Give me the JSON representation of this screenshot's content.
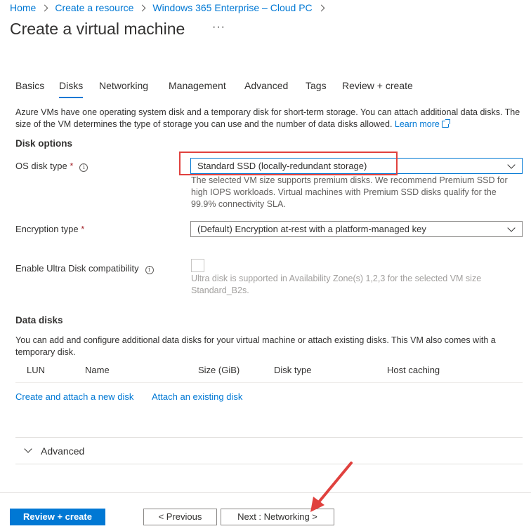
{
  "breadcrumb": [
    "Home",
    "Create a resource",
    "Windows 365 Enterprise – Cloud PC"
  ],
  "page_title": "Create a virtual machine",
  "more_label": "···",
  "tabs": [
    "Basics",
    "Disks",
    "Networking",
    "Management",
    "Advanced",
    "Tags",
    "Review + create"
  ],
  "active_tab": "Disks",
  "intro": {
    "text": "Azure VMs have one operating system disk and a temporary disk for short-term storage. You can attach additional data disks. The size of the VM determines the type of storage you can use and the number of data disks allowed.",
    "learn_more": "Learn more"
  },
  "disk_options": {
    "title": "Disk options",
    "os_disk_type_label": "OS disk type",
    "os_disk_type_value": "Standard SSD (locally-redundant storage)",
    "os_disk_help": "The selected VM size supports premium disks. We recommend Premium SSD for high IOPS workloads. Virtual machines with Premium SSD disks qualify for the 99.9% connectivity SLA.",
    "encryption_label": "Encryption type",
    "encryption_value": "(Default) Encryption at-rest with a platform-managed key",
    "ultra_label": "Enable Ultra Disk compatibility",
    "ultra_help": "Ultra disk is supported in Availability Zone(s) 1,2,3 for the selected VM size Standard_B2s."
  },
  "data_disks": {
    "title": "Data disks",
    "description": "You can add and configure additional data disks for your virtual machine or attach existing disks. This VM also comes with a temporary disk.",
    "columns": [
      "LUN",
      "Name",
      "Size (GiB)",
      "Disk type",
      "Host caching"
    ],
    "create_link": "Create and attach a new disk",
    "attach_link": "Attach an existing disk"
  },
  "advanced_section": "Advanced",
  "footer": {
    "review_create": "Review + create",
    "previous": "< Previous",
    "next": "Next : Networking >"
  },
  "colors": {
    "accent": "#0078d4",
    "annotation": "#e0413e",
    "required": "#a4262c"
  }
}
